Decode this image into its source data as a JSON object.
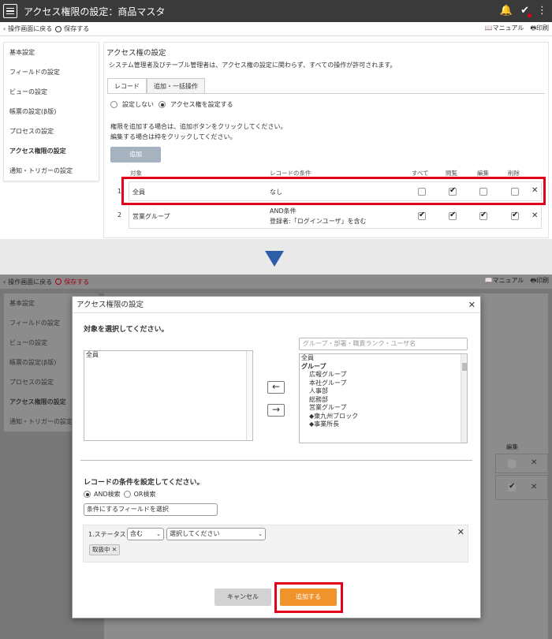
{
  "app": {
    "title": "アクセス権限の設定：商品マスタ",
    "bell_icon": "bell-icon",
    "check_icon": "check-icon",
    "more_icon": "more-vertical-icon"
  },
  "toolbar": {
    "back_label": "操作画面に戻る",
    "save_label": "保存する",
    "manual_label": "マニュアル",
    "print_label": "印刷"
  },
  "sidebar": {
    "items": [
      {
        "label": "基本設定"
      },
      {
        "label": "フィールドの設定"
      },
      {
        "label": "ビューの設定"
      },
      {
        "label": "帳票の設定(β版)"
      },
      {
        "label": "プロセスの設定"
      },
      {
        "label": "アクセス権限の設定"
      },
      {
        "label": "通知・トリガーの設定"
      }
    ]
  },
  "main": {
    "heading": "アクセス権の設定",
    "description": "システム管理者及びテーブル管理者は、アクセス権の設定に関わらず、すべての操作が許可されます。",
    "tabs": [
      {
        "label": "レコード"
      },
      {
        "label": "追加・一括操作"
      }
    ],
    "radio_none": "設定しない",
    "radio_set": "アクセス権を設定する",
    "help_line1": "権限を追加する場合は、追加ボタンをクリックしてください。",
    "help_line2": "編集する場合は枠をクリックしてください。",
    "add_button": "追加",
    "columns": {
      "target": "対象",
      "condition": "レコードの条件",
      "all": "すべて",
      "view": "閲覧",
      "edit": "編集",
      "delete": "削除"
    },
    "rows": [
      {
        "num": "1",
        "target": "全員",
        "condition": "なし",
        "condition2": "",
        "all": false,
        "view": true,
        "edit": false,
        "delete": false
      },
      {
        "num": "2",
        "target": "営業グループ",
        "condition": "AND条件",
        "condition2": "登録者:「ログインユーザ」を含む",
        "all": true,
        "view": true,
        "edit": true,
        "delete": true
      }
    ]
  },
  "dialog": {
    "title": "アクセス権限の設定",
    "select_target_label": "対象を選択してください。",
    "selected_items": [
      "全員"
    ],
    "search_placeholder": "グループ・部署・職責ランク・ユーザ名",
    "available_items": [
      "全員",
      "グループ",
      "広報グループ",
      "本社グループ",
      "人事部",
      "総務部",
      "営業グループ",
      "◆東九州ブロック",
      "◆事業所長"
    ],
    "conditions_label": "レコードの条件を設定してください。",
    "and_label": "AND検索",
    "or_label": "OR検索",
    "field_select_placeholder": "条件にするフィールドを選択",
    "condition_row_label": "1.ステータス",
    "operator_value": "含む",
    "value_placeholder": "選択してください",
    "tag_label": "取扱中",
    "cancel_button": "キャンセル",
    "submit_button": "追加する"
  },
  "colors": {
    "titlebar": "#3a3a3a",
    "highlight": "#e0001a",
    "arrow": "#2e5ea8",
    "submit": "#f0932b",
    "add_button": "#a7b2c1"
  }
}
